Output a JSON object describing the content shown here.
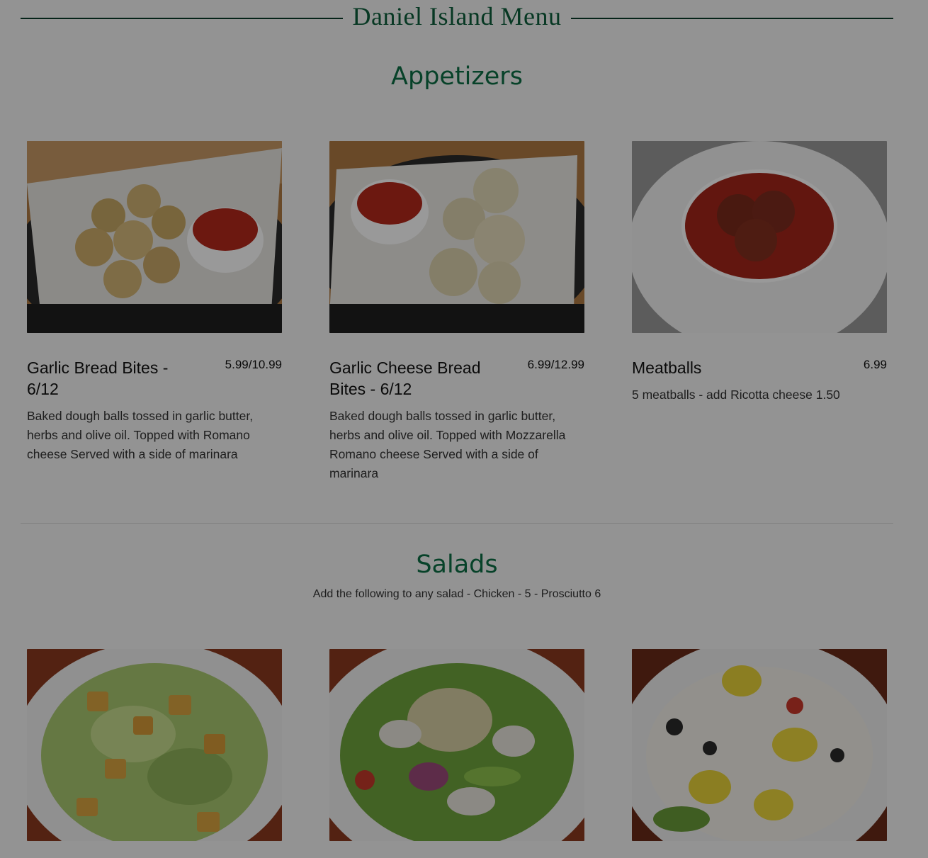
{
  "header": {
    "title": "Daniel Island Menu"
  },
  "sections": {
    "appetizers": {
      "title": "Appetizers",
      "items": [
        {
          "name": "Garlic Bread Bites - 6/12",
          "price": "5.99/10.99",
          "description": "Baked dough balls tossed in garlic butter, herbs and olive oil. Topped with Romano cheese Served with a side of marinara",
          "photo": "garlic-bread-bites-photo"
        },
        {
          "name": "Garlic Cheese Bread Bites - 6/12",
          "price": "6.99/12.99",
          "description": "Baked dough balls tossed in garlic butter, herbs and olive oil. Topped with  Mozzarella Romano cheese Served with a side of marinara",
          "photo": "garlic-cheese-bread-bites-photo"
        },
        {
          "name": "Meatballs",
          "price": "6.99",
          "description": "5 meatballs - add Ricotta cheese 1.50",
          "photo": "meatballs-photo"
        }
      ]
    },
    "salads": {
      "title": "Salads",
      "subtitle": "Add the following to any salad - Chicken - 5 - Prosciutto 6",
      "items": [
        {
          "photo": "caesar-salad-photo"
        },
        {
          "photo": "garden-salad-photo"
        },
        {
          "photo": "greek-salad-photo"
        }
      ]
    }
  },
  "colors": {
    "accent": "#0d6e45",
    "header_line": "#0a3d2a",
    "background": "#f5f5f5",
    "overlay": "rgba(0,0,0,0.40)"
  }
}
